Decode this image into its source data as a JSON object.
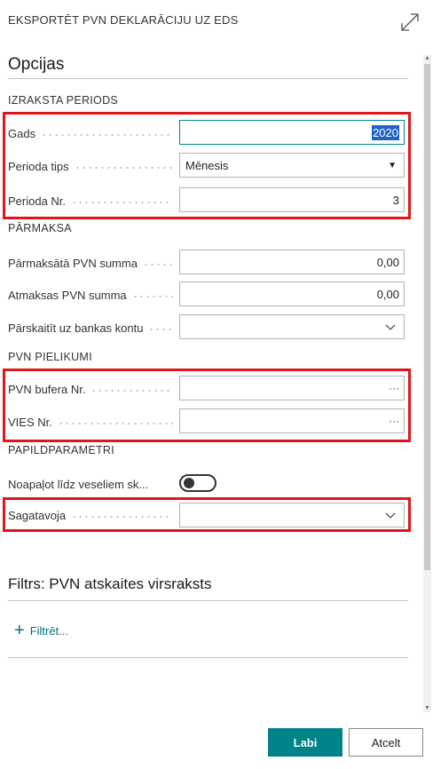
{
  "dialog": {
    "title": "EKSPORTĒT PVN DEKLARĀCIJU UZ EDS"
  },
  "options": {
    "title": "Opcijas",
    "period_group": "IZRAKSTA PERIODS",
    "year_label": "Gads",
    "year_value": "2020",
    "period_type_label": "Perioda tips",
    "period_type_value": "Mēnesis",
    "period_no_label": "Perioda Nr.",
    "period_no_value": "3",
    "overpay_group": "PĀRMAKSA",
    "overpaid_vat_label": "Pārmaksātā PVN summa",
    "overpaid_vat_value": "0,00",
    "refund_vat_label": "Atmaksas PVN summa",
    "refund_vat_value": "0,00",
    "transfer_bank_label": "Pārskaitīt uz bankas kontu",
    "transfer_bank_value": "",
    "attachments_group": "PVN PIELIKUMI",
    "vat_buffer_label": "PVN bufera Nr.",
    "vat_buffer_value": "",
    "vies_label": "VIES Nr.",
    "vies_value": "",
    "extra_group": "PAPILDPARAMETRI",
    "round_label": "Noapaļot līdz veseliem sk...",
    "round_enabled": false,
    "prepared_label": "Sagatavoja",
    "prepared_value": "",
    "ellipsis": "···"
  },
  "filters": {
    "title": "Filtrs: PVN atskaites virsraksts",
    "add_label": "Filtrēt..."
  },
  "footer": {
    "ok_label": "Labi",
    "cancel_label": "Atcelt"
  },
  "colors": {
    "accent": "#008489",
    "highlight": "#e0161a",
    "selection": "#1e64c8"
  }
}
